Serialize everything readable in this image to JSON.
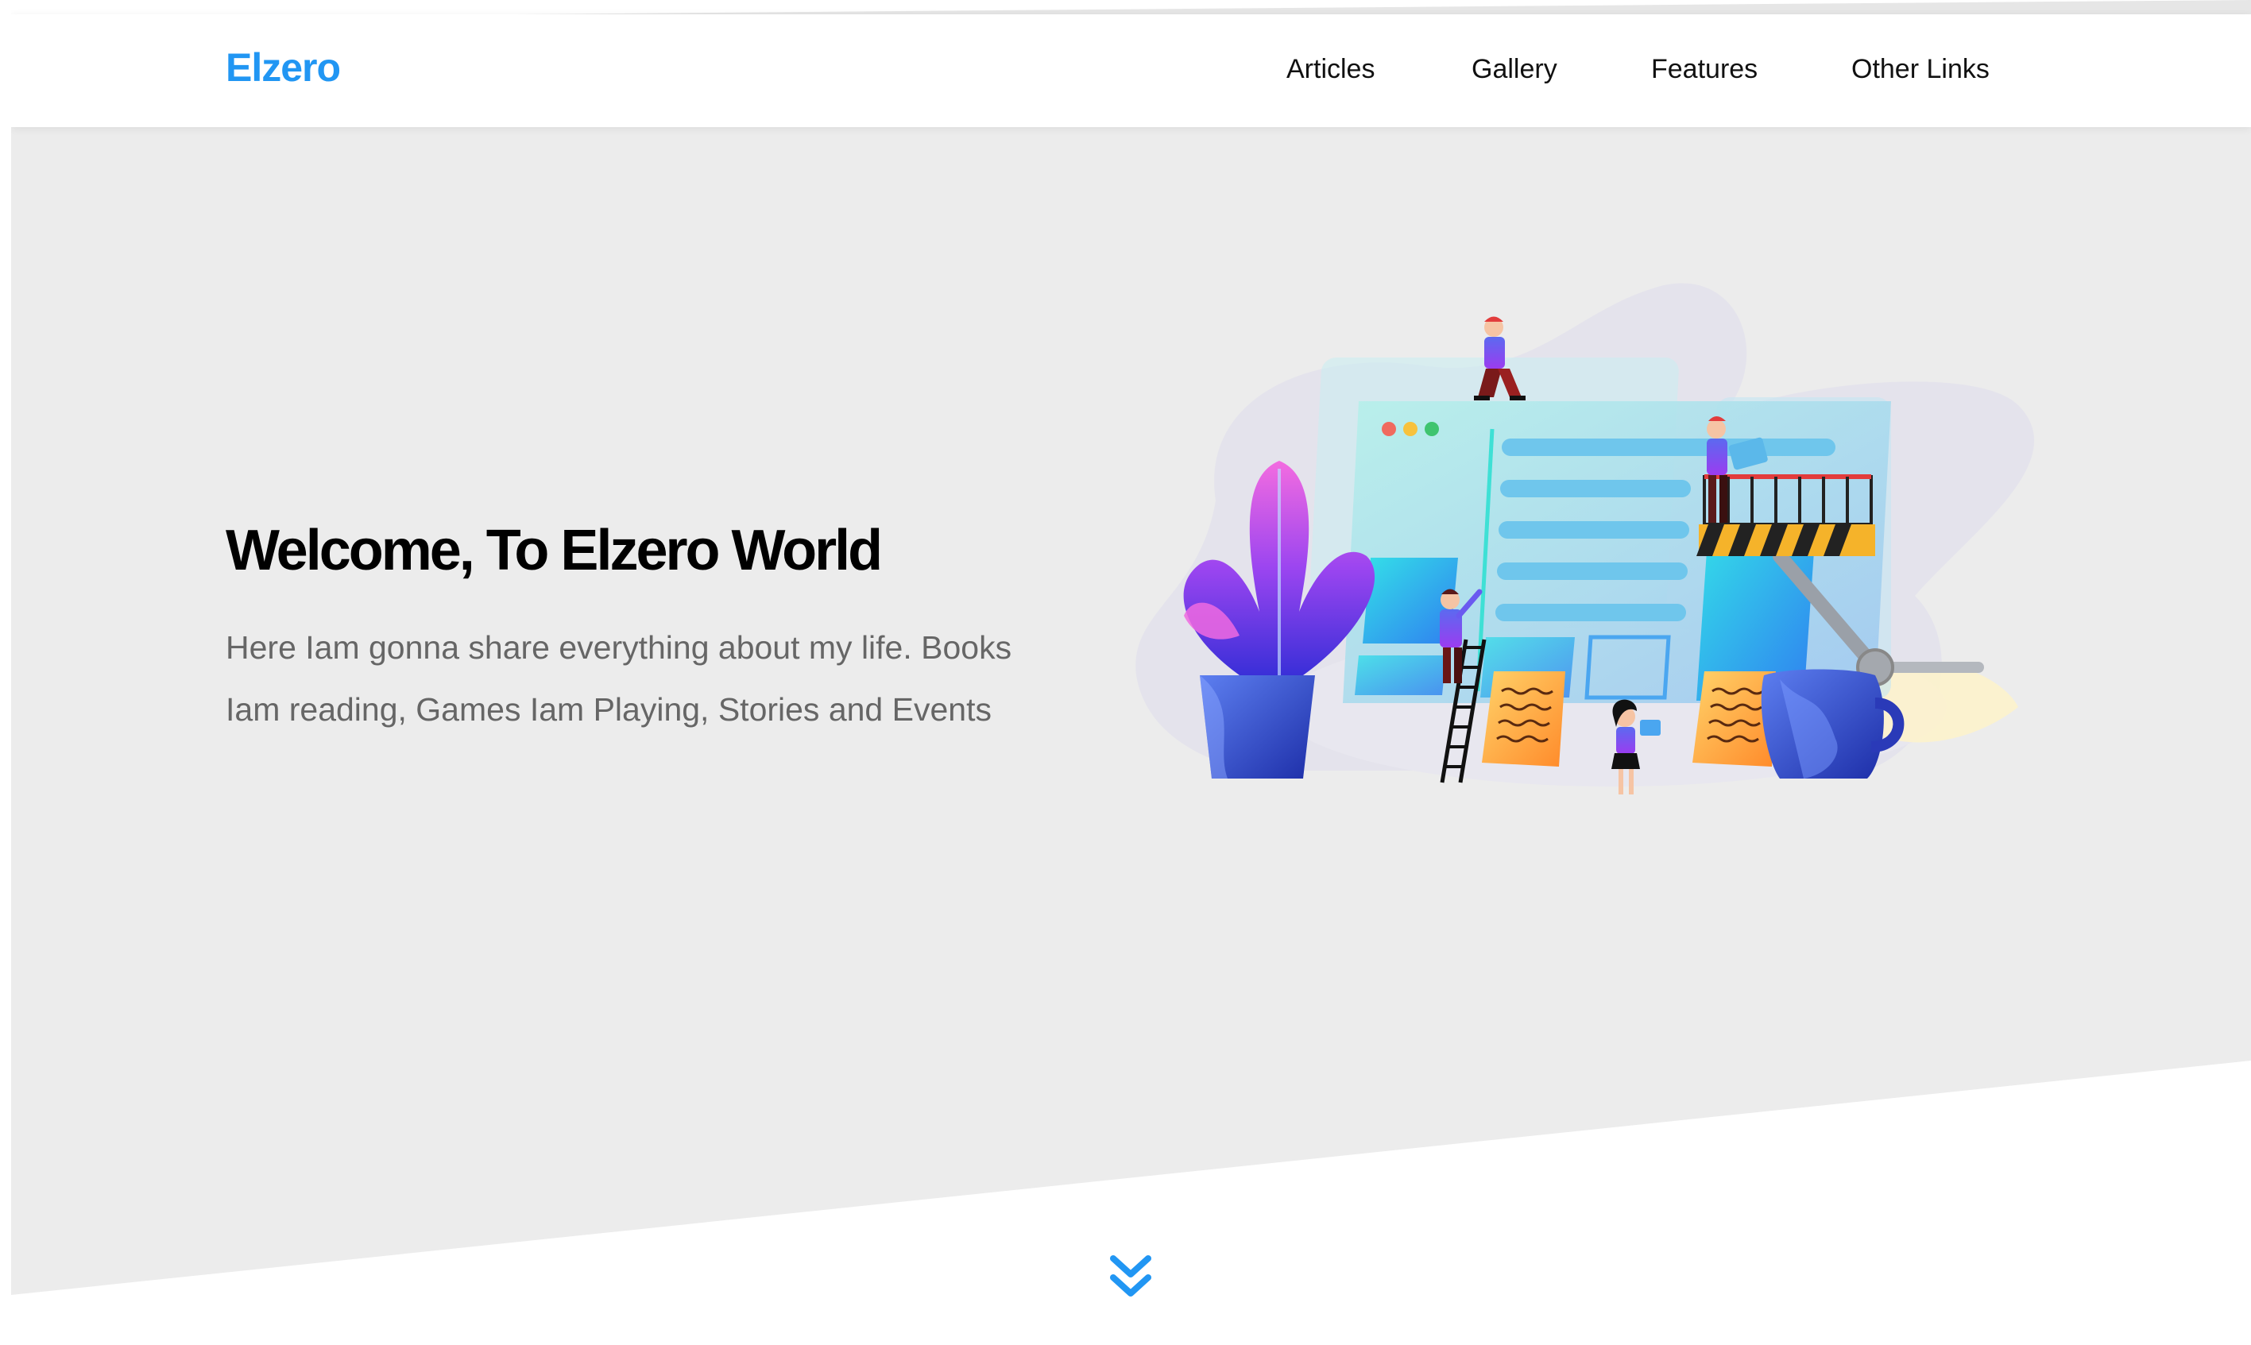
{
  "header": {
    "logo": "Elzero",
    "nav": [
      {
        "label": "Articles"
      },
      {
        "label": "Gallery"
      },
      {
        "label": "Features"
      },
      {
        "label": "Other Links"
      }
    ]
  },
  "hero": {
    "title": "Welcome, To Elzero World",
    "description": "Here Iam gonna share everything about my life. Books Iam reading, Games Iam Playing, Stories and Events",
    "illustration_icon": "web-development-illustration",
    "scroll_icon": "double-chevron-down-icon"
  },
  "colors": {
    "accent": "#2196f3",
    "hero_bg": "#ececec",
    "text_dark": "#000000",
    "text_muted": "#666666"
  }
}
